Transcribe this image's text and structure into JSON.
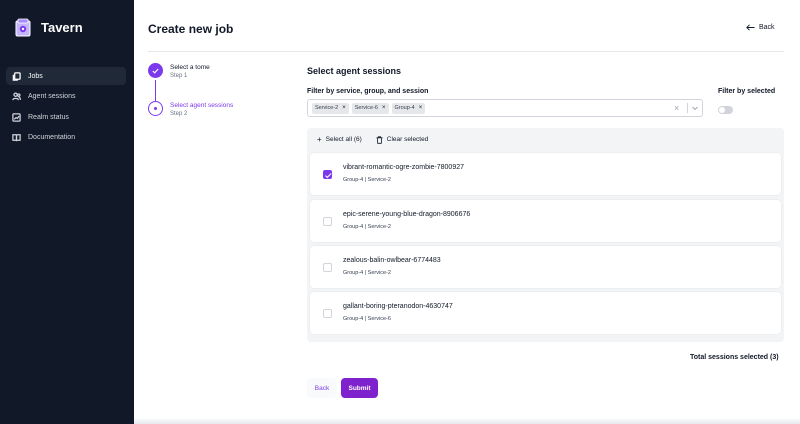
{
  "app": {
    "name": "Tavern"
  },
  "sidebar": {
    "items": [
      {
        "label": "Jobs",
        "icon": "document-stack-icon",
        "active": true
      },
      {
        "label": "Agent sessions",
        "icon": "users-icon"
      },
      {
        "label": "Realm status",
        "icon": "chart-icon"
      },
      {
        "label": "Documentation",
        "icon": "book-icon"
      }
    ]
  },
  "header": {
    "title": "Create new job",
    "back_label": "Back"
  },
  "stepper": {
    "steps": [
      {
        "title": "Select a tome",
        "subtitle": "Step 1",
        "state": "done"
      },
      {
        "title": "Select agent sessions",
        "subtitle": "Step 2",
        "state": "current"
      }
    ]
  },
  "form": {
    "section_title": "Select agent sessions",
    "filter_label": "Filter by service, group, and session",
    "filter_selected_label": "Filter by selected",
    "chips": [
      "Service-2",
      "Service-6",
      "Group-4"
    ],
    "clear_symbol": "×",
    "chip_remove_symbol": "×",
    "select_all_label": "Select all (6)",
    "clear_selected_label": "Clear selected",
    "sessions": [
      {
        "name": "vibrant-romantic-ogre-zombie-7800927",
        "meta": "Group-4 | Service-2",
        "checked": true
      },
      {
        "name": "epic-serene-young-blue-dragon-8906676",
        "meta": "Group-4 | Service-2",
        "checked": false
      },
      {
        "name": "zealous-balin-owlbear-6774483",
        "meta": "Group-4 | Service-2",
        "checked": false
      },
      {
        "name": "gallant-boring-pteranodon-4630747",
        "meta": "Group-4 | Service-6",
        "checked": false
      }
    ],
    "total_label": "Total sessions selected (3)",
    "back_button": "Back",
    "submit_button": "Submit"
  },
  "colors": {
    "accent": "#7c3aed",
    "sidebar_bg": "#111827",
    "submit_bg": "#7e22ce"
  }
}
